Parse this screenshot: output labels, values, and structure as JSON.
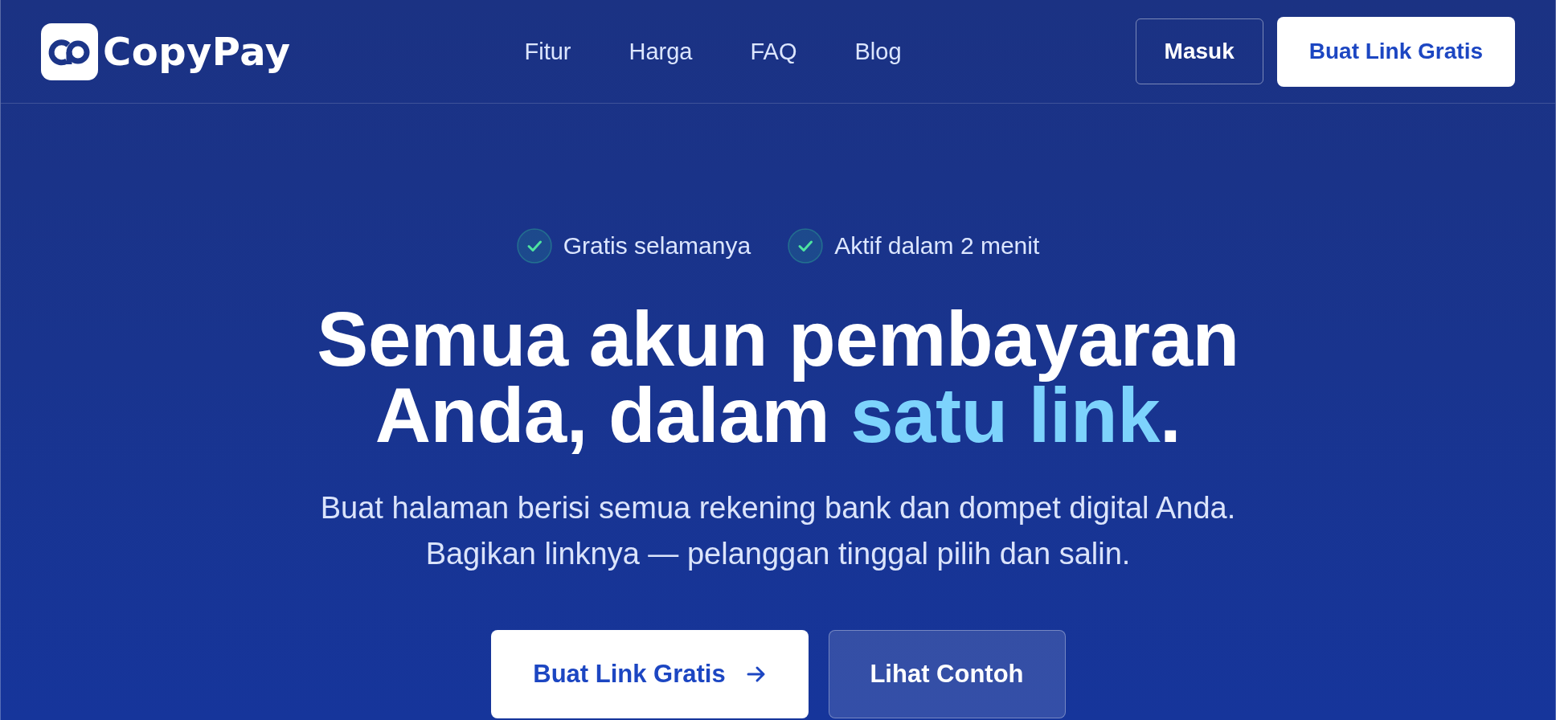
{
  "header": {
    "logo": {
      "name": "CopyPay"
    },
    "nav": [
      {
        "label": "Fitur"
      },
      {
        "label": "Harga"
      },
      {
        "label": "FAQ"
      },
      {
        "label": "Blog"
      }
    ],
    "actions": [
      {
        "label": "Masuk",
        "kind": "outline"
      },
      {
        "label": "Buat Link Gratis",
        "kind": "solid"
      }
    ]
  },
  "hero": {
    "badges": [
      {
        "label": "Gratis selamanya"
      },
      {
        "label": "Aktif dalam 2 menit"
      }
    ],
    "headline": {
      "text": "Semua akun pembayaran Anda, dalam ",
      "highlight": "satu link",
      "end": "."
    },
    "subtitle": "Buat halaman berisi semua rekening bank dan dompet digital Anda. Bagikan linknya — pelanggan tinggal pilih dan salin.",
    "buttons": [
      {
        "label": "Buat Link Gratis",
        "kind": "primary",
        "arrow": true
      },
      {
        "label": "Lihat Contoh",
        "kind": "secondary"
      }
    ]
  }
}
